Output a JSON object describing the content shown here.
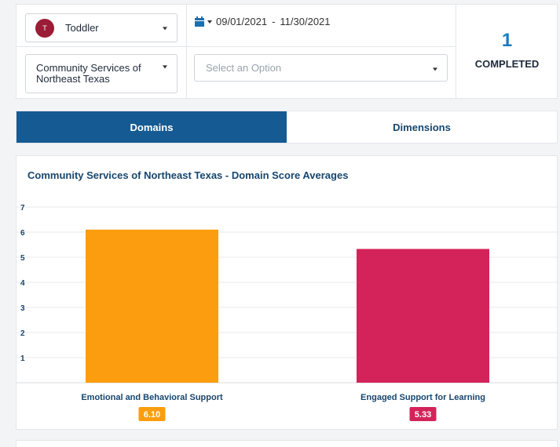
{
  "filters": {
    "age_group": {
      "avatar_letter": "T",
      "label": "Toddler"
    },
    "date_range": {
      "start": "09/01/2021",
      "separator": "-",
      "end": "11/30/2021"
    },
    "agency": {
      "label": "Community Services of Northeast Texas"
    },
    "option": {
      "placeholder": "Select an Option"
    }
  },
  "completed": {
    "count": "1",
    "label": "COMPLETED"
  },
  "tabs": [
    {
      "label": "Domains",
      "active": true
    },
    {
      "label": "Dimensions",
      "active": false
    }
  ],
  "chart_title": "Community Services of Northeast Texas - Domain Score Averages",
  "chart_data": {
    "type": "bar",
    "title": "Community Services of Northeast Texas - Domain Score Averages",
    "categories": [
      "Emotional and Behavioral Support",
      "Engaged Support for Learning"
    ],
    "values": [
      6.1,
      5.33
    ],
    "value_labels": [
      "6.10",
      "5.33"
    ],
    "colors": [
      "#fb9d0f",
      "#d4235a"
    ],
    "yticks": [
      "7",
      "6",
      "5",
      "4",
      "3",
      "2",
      "1"
    ],
    "ylim": [
      0,
      7
    ],
    "grid": true,
    "legend": "none"
  },
  "icons": {
    "calendar": "calendar-icon",
    "caret": "chevron-down-icon"
  }
}
